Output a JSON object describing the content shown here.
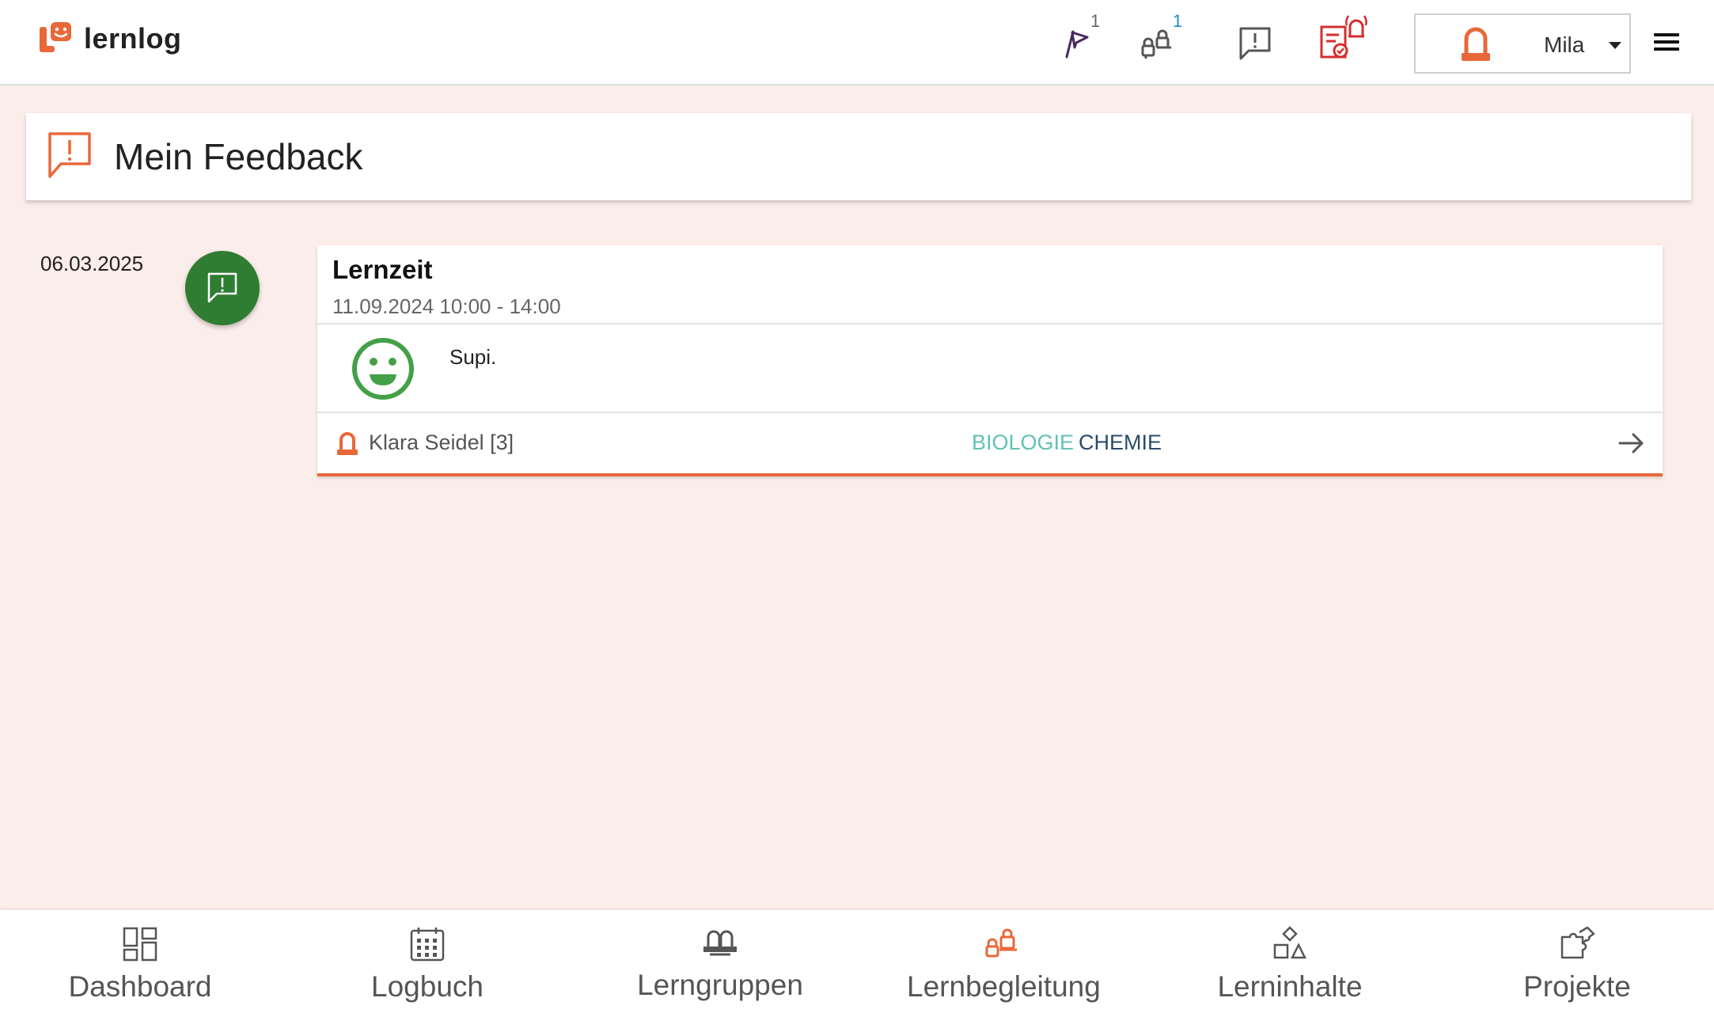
{
  "app": {
    "name": "lernlog"
  },
  "colors": {
    "accent": "#e8683a",
    "success": "#2e7d32",
    "tag_biologie": "#5fc2b5",
    "tag_chemie": "#2c4a6b"
  },
  "header": {
    "icons": [
      {
        "name": "flag-icon",
        "badge": "1"
      },
      {
        "name": "learning-support-icon",
        "badge": "1"
      },
      {
        "name": "feedback-icon",
        "badge": ""
      },
      {
        "name": "task-alarm-icon",
        "badge": ""
      }
    ],
    "user": {
      "name": "Mila"
    }
  },
  "page": {
    "title": "Mein Feedback"
  },
  "feedback": [
    {
      "date": "06.03.2025",
      "title": "Lernzeit",
      "time": "11.09.2024 10:00 - 14:00",
      "rating": "happy",
      "comment": "Supi.",
      "author": "Klara Seidel [3]",
      "tags": [
        "BIOLOGIE",
        "CHEMIE"
      ]
    }
  ],
  "nav": [
    {
      "label": "Dashboard",
      "icon": "dashboard-icon",
      "active": false
    },
    {
      "label": "Logbuch",
      "icon": "calendar-icon",
      "active": false
    },
    {
      "label": "Lerngruppen",
      "icon": "group-icon",
      "active": false
    },
    {
      "label": "Lernbegleitung",
      "icon": "learning-support-icon",
      "active": true
    },
    {
      "label": "Lerninhalte",
      "icon": "shapes-icon",
      "active": false
    },
    {
      "label": "Projekte",
      "icon": "puzzle-icon",
      "active": false
    }
  ]
}
